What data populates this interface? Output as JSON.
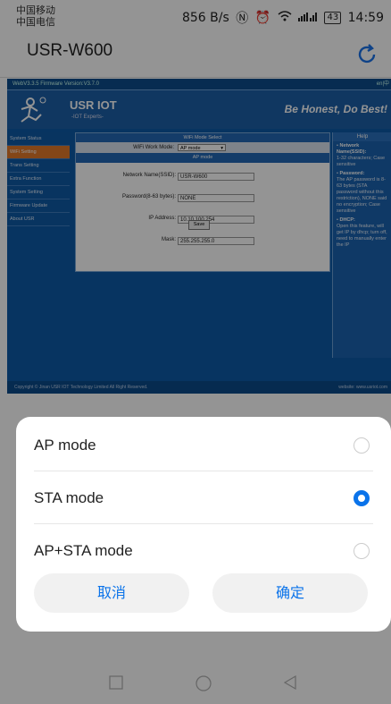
{
  "status_bar": {
    "carrier_1": "中国移动",
    "carrier_2": "中国电信",
    "speed": "856 B/s",
    "battery": "43",
    "time": "14:59"
  },
  "app_bar": {
    "url": "USR-W600",
    "refresh_icon": "refresh-icon"
  },
  "web": {
    "version": "WebV3.3.5   Firmware Version:V3.7.0",
    "version_right": "en|中",
    "brand": "USR IOT",
    "brand_sub": "-IOT Experts-",
    "slogan": "Be Honest, Do Best!",
    "nav": [
      "System Status",
      "WiFi Setting",
      "Trans Setting",
      "Extra Function",
      "System Setting",
      "Firmware Update",
      "About USR"
    ],
    "panel_title": "WiFi Mode Select",
    "mode_label": "WiFi Work Mode:",
    "mode_value": "AP mode",
    "sub_title": "AP mode",
    "fields": [
      {
        "label": "Network Name(SSID):",
        "value": "USR-W600"
      },
      {
        "label": "Password(8-63 bytes):",
        "value": "NONE"
      },
      {
        "label": "IP Address:",
        "value": "10.10.100.254"
      },
      {
        "label": "Mask:",
        "value": "255.255.255.0"
      }
    ],
    "save": "Save",
    "help_title": "Help",
    "help_items": [
      {
        "title": "Network Name(SSID):",
        "text": "1-32 characters; Case sensitive"
      },
      {
        "title": "Password:",
        "text": "The AP password is 8-63 bytes (STA password without this restriction), NONE said no encryption; Case sensitive"
      },
      {
        "title": "DHCP:",
        "text": "Open this feature, will get IP by dhcp; turn off, need to manually enter the IP"
      }
    ],
    "footer": "Copyright © Jinan USR IOT Technology Limited All Right Reserved.",
    "footer_right": "website: www.usriot.com"
  },
  "dialog": {
    "options": [
      {
        "label": "AP mode",
        "selected": false
      },
      {
        "label": "STA mode",
        "selected": true
      },
      {
        "label": "AP+STA mode",
        "selected": false
      }
    ],
    "cancel": "取消",
    "confirm": "确定",
    "accent": "#0a73ea"
  }
}
